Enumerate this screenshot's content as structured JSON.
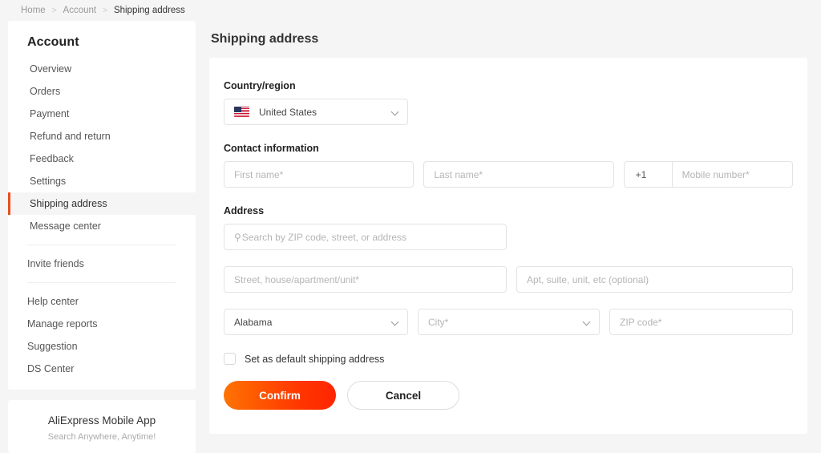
{
  "breadcrumb": {
    "separator": ">",
    "items": [
      {
        "label": "Home"
      },
      {
        "label": "Account"
      },
      {
        "label": "Shipping address"
      }
    ]
  },
  "sidebar": {
    "title": "Account",
    "primary_items": [
      {
        "label": "Overview"
      },
      {
        "label": "Orders"
      },
      {
        "label": "Payment"
      },
      {
        "label": "Refund and return"
      },
      {
        "label": "Feedback"
      },
      {
        "label": "Settings"
      },
      {
        "label": "Shipping address"
      },
      {
        "label": "Message center"
      }
    ],
    "group_two": [
      {
        "label": "Invite friends"
      }
    ],
    "group_three": [
      {
        "label": "Help center"
      },
      {
        "label": "Manage reports"
      },
      {
        "label": "Suggestion"
      },
      {
        "label": "DS Center"
      }
    ],
    "active_label": "Shipping address",
    "app_card": {
      "title": "AliExpress Mobile App",
      "subtitle": "Search Anywhere, Anytime!"
    }
  },
  "main": {
    "heading": "Shipping address",
    "sections": {
      "country": {
        "label": "Country/region",
        "selected": "United States",
        "flag_icon": "us-flag-icon",
        "chevron_icon": "chevron-down-icon"
      },
      "contact": {
        "label": "Contact information",
        "first_name_placeholder": "First name*",
        "last_name_placeholder": "Last name*",
        "phone_code": "+1",
        "mobile_placeholder": "Mobile number*"
      },
      "address": {
        "label": "Address",
        "search_icon": "search-icon",
        "search_placeholder": "Search by ZIP code, street, or address",
        "street_placeholder": "Street, house/apartment/unit*",
        "apt_placeholder": "Apt, suite, unit, etc (optional)",
        "state_value": "Alabama",
        "city_placeholder": "City*",
        "zip_placeholder": "ZIP code*"
      }
    },
    "default_checkbox_label": "Set as default shipping address",
    "confirm_label": "Confirm",
    "cancel_label": "Cancel"
  },
  "colors": {
    "accent": "#e94f1d",
    "confirm_start": "#ff7302",
    "confirm_end": "#ff2400",
    "page_bg": "#f5f5f5"
  }
}
